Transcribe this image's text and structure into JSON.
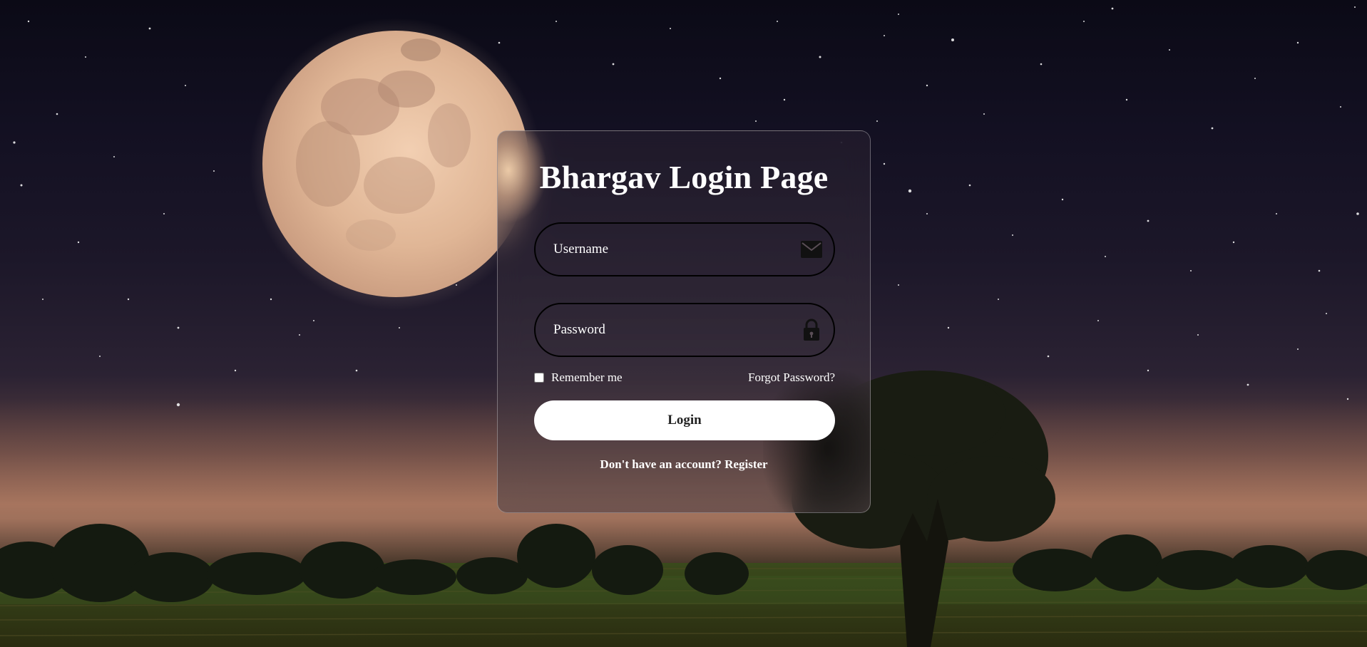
{
  "page": {
    "title": "Bhargav Login Page"
  },
  "form": {
    "username": {
      "placeholder": "Username",
      "value": "",
      "icon": "mail-icon"
    },
    "password": {
      "placeholder": "Password",
      "value": "",
      "icon": "lock-icon"
    },
    "remember_label": "Remember me",
    "remember_checked": false,
    "forgot_label": "Forgot Password?",
    "login_label": "Login",
    "register_prompt": "Don't have an account?",
    "register_label": "Register"
  },
  "colors": {
    "text": "#ffffff",
    "button_bg": "#ffffff",
    "button_text": "#222222",
    "input_border": "#000000"
  }
}
